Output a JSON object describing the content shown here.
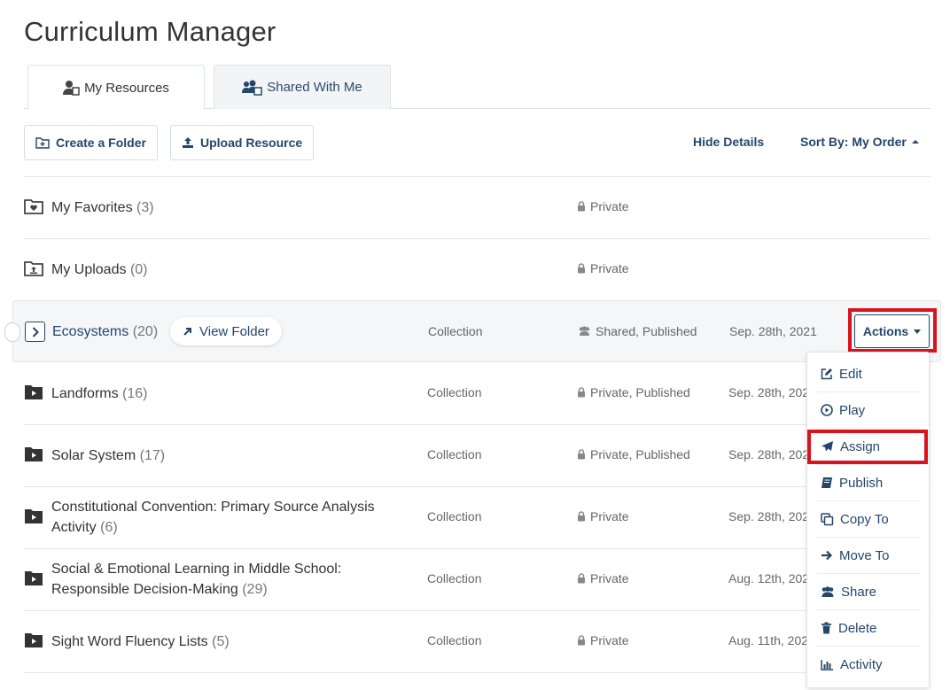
{
  "page": {
    "title": "Curriculum Manager"
  },
  "tabs": [
    {
      "label": "My Resources",
      "active": true,
      "icon": "user-file-icon"
    },
    {
      "label": "Shared With Me",
      "active": false,
      "icon": "users-file-icon"
    }
  ],
  "toolbar": {
    "create_folder": "Create a Folder",
    "upload_resource": "Upload Resource",
    "hide_details": "Hide Details",
    "sort_by": "Sort By: My Order"
  },
  "rows": [
    {
      "icon": "heart-folder-icon",
      "name": "My Favorites",
      "count": "(3)",
      "type": "",
      "privacy": "Private",
      "privacy_icon": "lock-icon",
      "date": ""
    },
    {
      "icon": "upload-folder-icon",
      "name": "My Uploads",
      "count": "(0)",
      "type": "",
      "privacy": "Private",
      "privacy_icon": "lock-icon",
      "date": ""
    },
    {
      "icon": "chevron-right-icon",
      "name": "Ecosystems",
      "count": "(20)",
      "type": "Collection",
      "privacy": "Shared, Published",
      "privacy_icon": "users-icon",
      "date": "Sep. 28th, 2021",
      "view_folder": "View Folder"
    },
    {
      "icon": "folder-play-icon",
      "name": "Landforms",
      "count": "(16)",
      "type": "Collection",
      "privacy": "Private, Published",
      "privacy_icon": "lock-icon",
      "date": "Sep. 28th, 2021"
    },
    {
      "icon": "folder-play-icon",
      "name": "Solar System",
      "count": "(17)",
      "type": "Collection",
      "privacy": "Private, Published",
      "privacy_icon": "lock-icon",
      "date": "Sep. 28th, 2021"
    },
    {
      "icon": "folder-play-icon",
      "name_line1": "Constitutional Convention: Primary Source Analysis",
      "name_line2": "Activity",
      "count": "(6)",
      "type": "Collection",
      "privacy": "Private",
      "privacy_icon": "lock-icon",
      "date": "Sep. 28th, 2021"
    },
    {
      "icon": "folder-play-icon",
      "name_line1": "Social & Emotional Learning in Middle School:",
      "name_line2": "Responsible Decision-Making",
      "count": "(29)",
      "type": "Collection",
      "privacy": "Private",
      "privacy_icon": "lock-icon",
      "date": "Aug. 12th, 2021"
    },
    {
      "icon": "folder-play-icon",
      "name": "Sight Word Fluency Lists",
      "count": "(5)",
      "type": "Collection",
      "privacy": "Private",
      "privacy_icon": "lock-icon",
      "date": "Aug. 11th, 2021"
    }
  ],
  "actions": {
    "label": "Actions",
    "menu": [
      {
        "label": "Edit",
        "icon": "edit-icon"
      },
      {
        "label": "Play",
        "icon": "play-circle-icon"
      },
      {
        "label": "Assign",
        "icon": "paper-plane-icon",
        "highlighted": true
      },
      {
        "label": "Publish",
        "icon": "book-icon"
      },
      {
        "label": "Copy To",
        "icon": "copy-icon"
      },
      {
        "label": "Move To",
        "icon": "arrow-right-icon"
      },
      {
        "label": "Share",
        "icon": "users-icon"
      },
      {
        "label": "Delete",
        "icon": "trash-icon"
      },
      {
        "label": "Activity",
        "icon": "bar-chart-icon"
      }
    ]
  },
  "colors": {
    "accent": "#24466b",
    "highlight_outline": "#d9131c",
    "text": "#333333",
    "muted": "#666666"
  }
}
